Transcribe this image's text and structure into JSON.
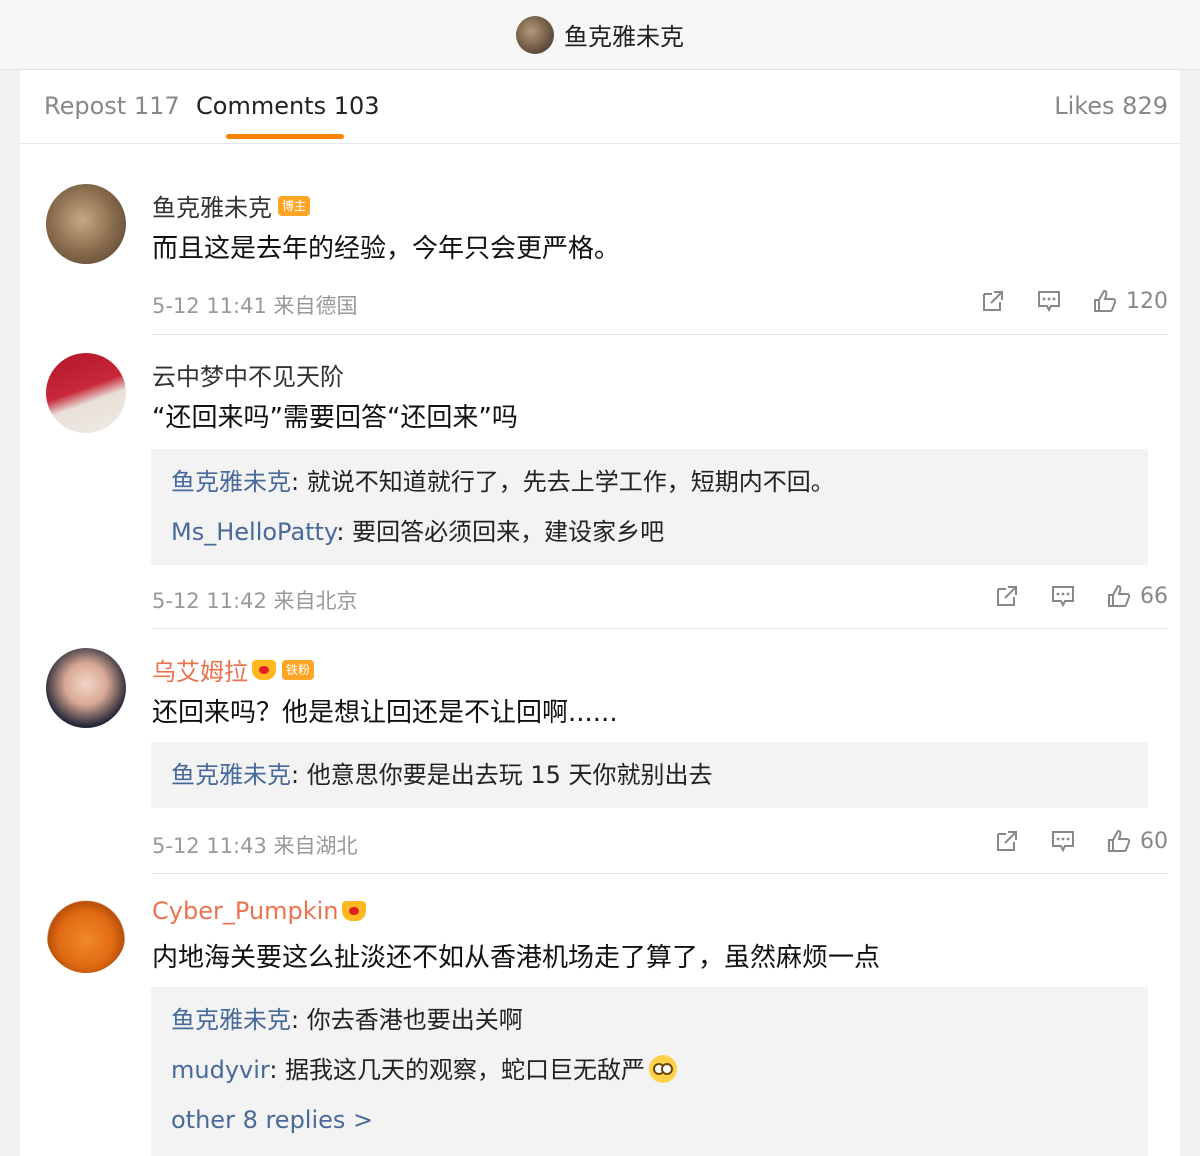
{
  "topbar": {
    "title": "鱼克雅未克"
  },
  "tabs": {
    "repost": "Repost 117",
    "comments": "Comments 103",
    "likes": "Likes 829"
  },
  "comments": [
    {
      "name": "鱼克雅未克",
      "badge": "博主",
      "text": "而且这是去年的经验，今年只会更严格。",
      "meta": "5-12 11:41 来自德国",
      "likes": "120",
      "replies": []
    },
    {
      "name": "云中梦中不见天阶",
      "text": "“还回来吗”需要回答“还回来”吗",
      "meta": "5-12 11:42 来自北京",
      "likes": "66",
      "replies": [
        {
          "name": "鱼克雅未克",
          "text": ": 就说不知道就行了，先去上学工作，短期内不回。"
        },
        {
          "name": "Ms_HelloPatty",
          "text": ": 要回答必须回来，建设家乡吧"
        }
      ]
    },
    {
      "name": "乌艾姆拉",
      "badge": "铁粉",
      "text": "还回来吗？他是想让回还是不让回啊......",
      "meta": "5-12 11:43 来自湖北",
      "likes": "60",
      "replies": [
        {
          "name": "鱼克雅未克",
          "text": ": 他意思你要是出去玩 15 天你就别出去"
        }
      ]
    },
    {
      "name": "Cyber_Pumpkin",
      "text": "内地海关要这么扯淡还不如从香港机场走了算了，虽然麻烦一点",
      "replies": [
        {
          "name": "鱼克雅未克",
          "text": ": 你去香港也要出关啊"
        },
        {
          "name": "mudyvir",
          "text": ": 据我这几天的观察，蛇口巨无敌严"
        }
      ],
      "more_replies": "other 8 replies >"
    }
  ],
  "colors": {
    "accent": "#ff8200",
    "link": "#486a9b",
    "vip_name": "#eb7350"
  },
  "icons": [
    "repost-icon",
    "comment-icon",
    "thumbs-up-icon"
  ]
}
